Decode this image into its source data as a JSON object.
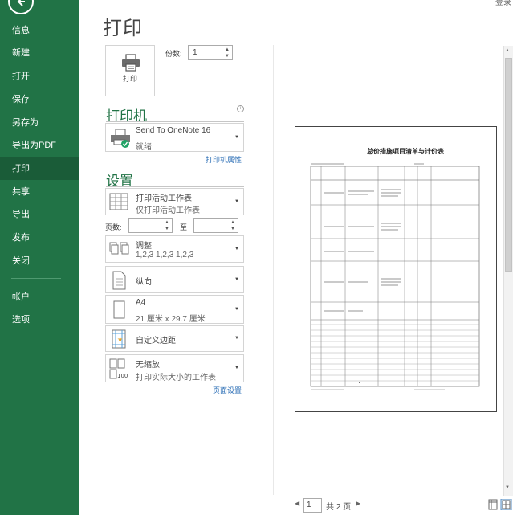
{
  "nav": {
    "items": [
      {
        "label": "信息",
        "active": false
      },
      {
        "label": "新建",
        "active": false
      },
      {
        "label": "打开",
        "active": false
      },
      {
        "label": "保存",
        "active": false
      },
      {
        "label": "另存为",
        "active": false
      },
      {
        "label": "导出为PDF",
        "active": false
      },
      {
        "label": "打印",
        "active": true
      },
      {
        "label": "共享",
        "active": false
      },
      {
        "label": "导出",
        "active": false
      },
      {
        "label": "发布",
        "active": false
      },
      {
        "label": "关闭",
        "active": false
      }
    ],
    "bottom_items": [
      {
        "label": "帐户"
      },
      {
        "label": "选项"
      }
    ]
  },
  "top_right": "登录",
  "page_title": "打印",
  "print_button_label": "打印",
  "copies": {
    "label": "份数:",
    "value": "1"
  },
  "printer": {
    "heading": "打印机",
    "name": "Send To OneNote 16",
    "status": "就绪",
    "properties_link": "打印机属性"
  },
  "settings": {
    "heading": "设置",
    "scope": {
      "title": "打印活动工作表",
      "subtitle": "仅打印活动工作表"
    },
    "pages_label": "页数:",
    "pages_to": "至",
    "collate": {
      "title": "调整",
      "subtitle": "1,2,3    1,2,3    1,2,3"
    },
    "orientation": {
      "title": "纵向"
    },
    "paper": {
      "title": "A4",
      "subtitle": "21 厘米 x 29.7 厘米"
    },
    "margins": {
      "title": "自定义边距"
    },
    "scaling": {
      "title": "无缩放",
      "subtitle": "打印实际大小的工作表"
    },
    "page_setup_link": "页面设置"
  },
  "preview": {
    "sheet_title": "总价措施项目清单与计价表"
  },
  "pager": {
    "current": "1",
    "of_text": "共 2 页"
  },
  "colors": {
    "nav_bg": "#217346",
    "nav_active": "#1a5c38",
    "accent": "#217346",
    "link": "#2a6db5"
  }
}
